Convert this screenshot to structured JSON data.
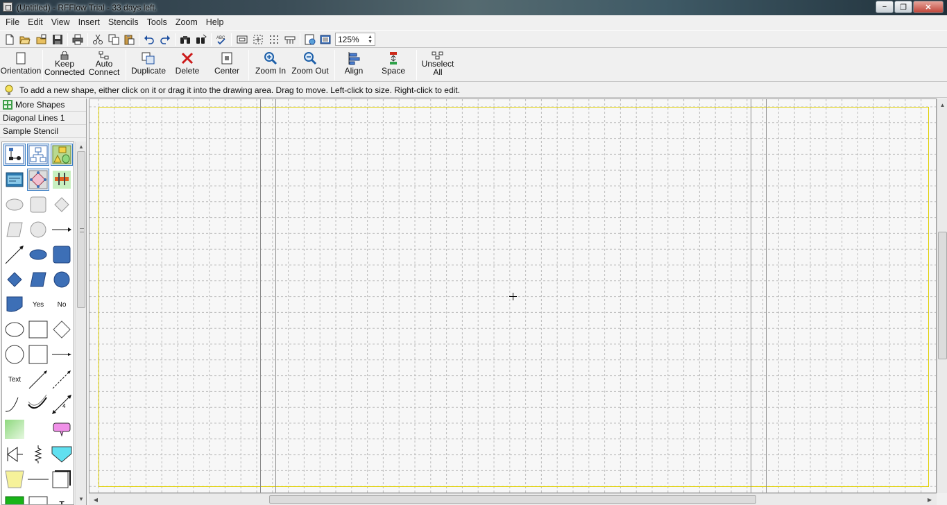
{
  "window": {
    "title": "(Untitled) - RFFlow Trial - 33 days left.",
    "minimize_label": "−",
    "maximize_label": "❐",
    "close_label": "✕"
  },
  "menu": [
    "File",
    "Edit",
    "View",
    "Insert",
    "Stencils",
    "Tools",
    "Zoom",
    "Help"
  ],
  "toolbar": {
    "icons": [
      "new-document-icon",
      "open-folder-icon",
      "open-stencil-icon",
      "save-icon",
      "print-icon",
      "cut-icon",
      "copy-icon",
      "paste-icon",
      "undo-icon",
      "redo-icon",
      "find-icon",
      "replace-icon",
      "spell-check-icon",
      "page-view-icon",
      "snap-grid-icon",
      "show-grid-icon",
      "ruler-icon",
      "properties-icon",
      "stencil-manager-icon"
    ],
    "zoom_value": "125%"
  },
  "command_bar": [
    {
      "label": "Orientation",
      "icon": "orientation-icon"
    },
    {
      "label": "Keep\nConnected",
      "icon": "keep-connected-icon"
    },
    {
      "label": "Auto\nConnect",
      "icon": "auto-connect-icon"
    },
    {
      "label": "Duplicate",
      "icon": "duplicate-icon"
    },
    {
      "label": "Delete",
      "icon": "delete-icon"
    },
    {
      "label": "Center",
      "icon": "center-icon"
    },
    {
      "label": "Zoom In",
      "icon": "zoom-in-icon"
    },
    {
      "label": "Zoom Out",
      "icon": "zoom-out-icon"
    },
    {
      "label": "Align",
      "icon": "align-icon"
    },
    {
      "label": "Space",
      "icon": "space-icon"
    },
    {
      "label": "Unselect\nAll",
      "icon": "unselect-all-icon"
    }
  ],
  "hint": {
    "icon": "lightbulb-icon",
    "text": "To add a new shape, either click on it or drag it into the drawing area. Drag to move. Left-click to size. Right-click to edit."
  },
  "sidebar": {
    "more_shapes": "More Shapes",
    "stencils": [
      "Diagonal Lines 1",
      "Sample Stencil"
    ],
    "shape_text": {
      "yes": "Yes",
      "no": "No",
      "text": "Text"
    }
  },
  "colors": {
    "accent_blue": "#3d6fb6",
    "page_border": "#e0d000",
    "canvas_bg": "#f7f7f7",
    "grid": "#bcbcbc",
    "delete_red": "#cc1a1a",
    "shape_green": "#8ed87e",
    "shape_cyan": "#60e0f0",
    "shape_pink": "#f090e8",
    "shape_yellow": "#f6f29a"
  }
}
